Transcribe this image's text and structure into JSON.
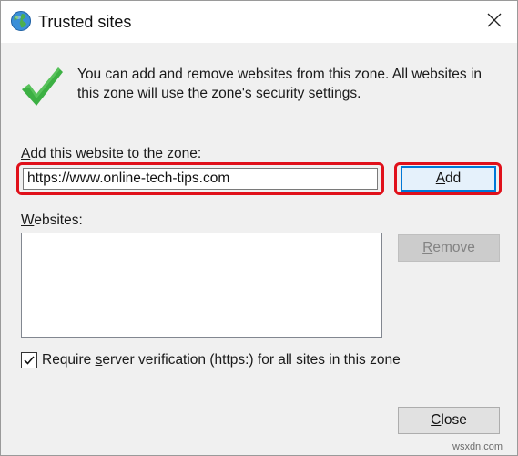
{
  "dialog": {
    "title": "Trusted sites",
    "info_text": "You can add and remove websites from this zone. All websites in this zone will use the zone's security settings."
  },
  "add_section": {
    "label_prefix": "",
    "label_accel": "A",
    "label_rest": "dd this website to the zone:",
    "url_value": "https://www.online-tech-tips.com",
    "add_button_accel": "A",
    "add_button_rest": "dd"
  },
  "websites_section": {
    "label_accel": "W",
    "label_rest": "ebsites:",
    "items": [],
    "remove_button_accel": "R",
    "remove_button_rest": "emove"
  },
  "verification": {
    "checked": true,
    "label_prefix": "Require ",
    "label_accel": "s",
    "label_rest": "erver verification (https:) for all sites in this zone"
  },
  "footer": {
    "close_button_accel": "C",
    "close_button_rest": "lose"
  },
  "watermark": "wsxdn.com",
  "colors": {
    "highlight": "#e0101a",
    "check_green": "#3cb043",
    "focus_blue": "#0078d7"
  },
  "icons": {
    "title": "globe-icon",
    "close": "close-icon",
    "info": "checkmark-icon",
    "checkbox": "checkbox-check-icon"
  }
}
